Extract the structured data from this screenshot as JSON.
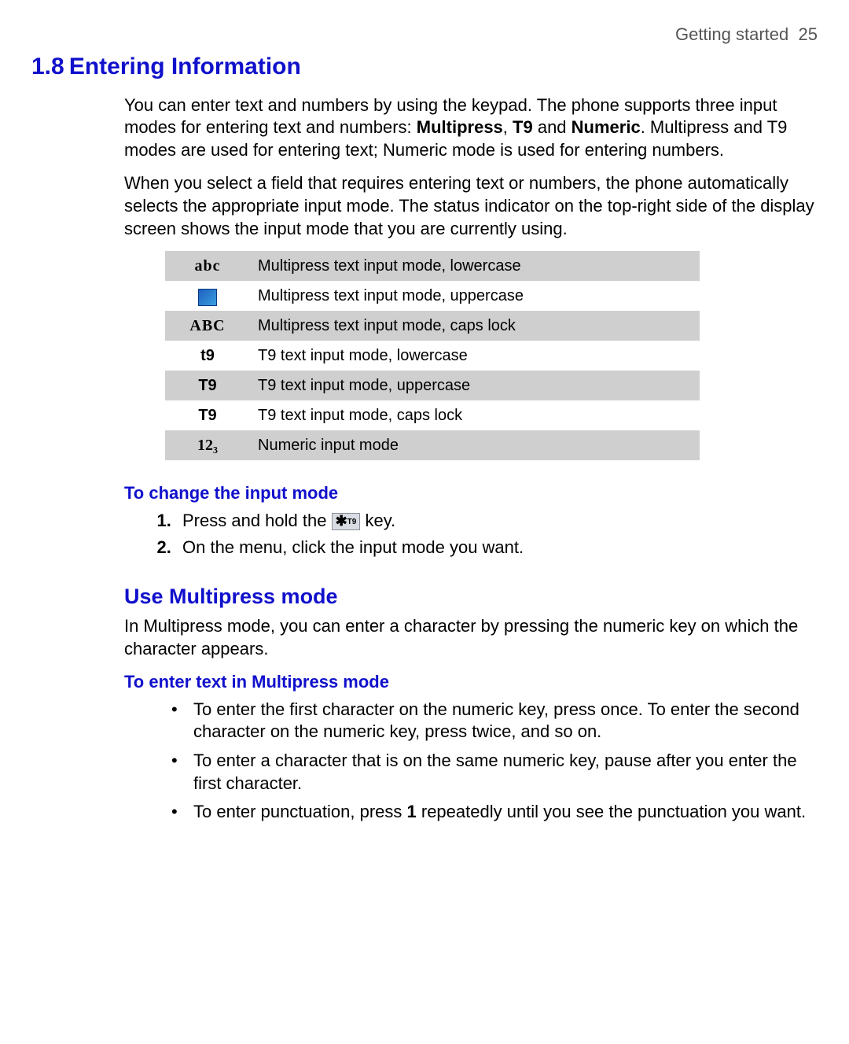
{
  "header": {
    "section": "Getting started",
    "page": "25"
  },
  "h1": {
    "num": "1.8",
    "title": "Entering Information"
  },
  "intro": {
    "p1a": "You can enter text and numbers by using the keypad. The phone supports three input modes for entering text and numbers: ",
    "p1b": "Multipress",
    "p1c": ", ",
    "p1d": "T9",
    "p1e": " and ",
    "p1f": "Numeric",
    "p1g": ". Multipress and T9 modes are used for entering text; Numeric mode is used for entering numbers.",
    "p2": "When you select a field that requires entering text or numbers, the phone automatically selects the appropriate input mode. The status indicator on the top-right side of the display screen shows the input mode that you are currently using."
  },
  "modes": [
    {
      "icon": "abc",
      "desc": "Multipress text input mode, lowercase"
    },
    {
      "icon": "",
      "desc": "Multipress text input mode, uppercase"
    },
    {
      "icon": "ABC",
      "desc": "Multipress text input mode, caps lock"
    },
    {
      "icon": "t9",
      "desc": "T9 text input mode, lowercase"
    },
    {
      "icon": "T9",
      "desc": "T9 text input mode, uppercase"
    },
    {
      "icon": "T9",
      "desc": "T9 text input mode, caps lock"
    },
    {
      "icon": "12₃",
      "desc": "Numeric input mode"
    }
  ],
  "change_mode": {
    "heading": "To change the input mode",
    "step1a": "Press and hold the ",
    "step1b": " key.",
    "step2": "On the menu, click the input mode you want."
  },
  "star_key": {
    "star": "✱",
    "t9": "T9"
  },
  "multipress": {
    "heading": "Use Multipress mode",
    "intro": "In Multipress mode, you can enter a character by pressing the numeric key on which the character appears.",
    "enter_heading": "To enter text in Multipress mode",
    "b1": "To enter the first character on the numeric key, press once. To enter the second character on the numeric key, press twice, and so on.",
    "b2": "To enter a character that is on the same numeric key, pause after you enter the first character.",
    "b3a": "To enter punctuation, press ",
    "b3b": "1",
    "b3c": " repeatedly until you see the punctuation you want."
  }
}
